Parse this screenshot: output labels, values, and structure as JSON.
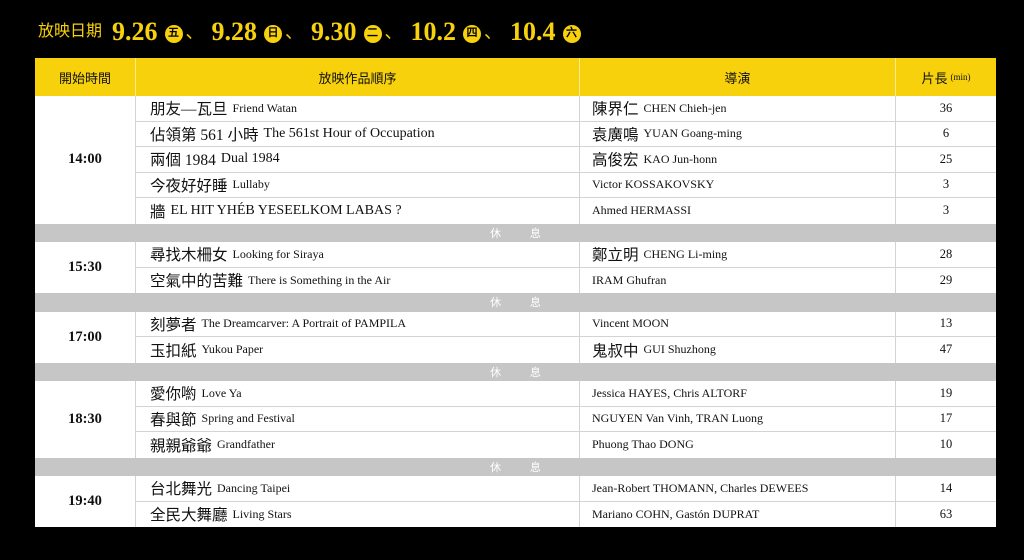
{
  "colors": {
    "page_background": "#000000",
    "accent_yellow": "#f7d10c",
    "intermission_gray": "#c6c6c6",
    "grid_line": "#d3d3d3",
    "text": "#111111"
  },
  "header": {
    "label": "放映日期",
    "separator": "、",
    "dates": [
      {
        "date": "9.26",
        "weekday": "五"
      },
      {
        "date": "9.28",
        "weekday": "日"
      },
      {
        "date": "9.30",
        "weekday": "二"
      },
      {
        "date": "10.2",
        "weekday": "四"
      },
      {
        "date": "10.4",
        "weekday": "六"
      }
    ]
  },
  "table": {
    "columns": {
      "start_time": "開始時間",
      "program": "放映作品順序",
      "director": "導演",
      "length": "片長",
      "length_unit": "(min)"
    },
    "break_label": "休 息",
    "sessions": [
      {
        "time": "14:00",
        "films": [
          {
            "title_zh": "朋友—瓦旦",
            "title_en": "Friend Watan",
            "director_zh": "陳界仁",
            "director_en": "CHEN Chieh-jen",
            "length": "36"
          },
          {
            "title_zh": "佔領第 561 小時",
            "title_en": "The 561st Hour of Occupation",
            "director_zh": "袁廣鳴",
            "director_en": "YUAN Goang-ming",
            "length": "6"
          },
          {
            "title_zh": "兩個 1984",
            "title_en": "Dual 1984",
            "director_zh": "高俊宏",
            "director_en": "KAO Jun-honn",
            "length": "25"
          },
          {
            "title_zh": "今夜好好睡",
            "title_en": "Lullaby",
            "director_en": "Victor KOSSAKOVSKY",
            "length": "3"
          },
          {
            "title_zh": "牆",
            "title_en": "EL HIT YHÉB YESEELKOM LABAS ?",
            "director_en": "Ahmed HERMASSI",
            "length": "3"
          }
        ]
      },
      {
        "time": "15:30",
        "films": [
          {
            "title_zh": "尋找木柵女",
            "title_en": "Looking for Siraya",
            "director_zh": "鄭立明",
            "director_en": "CHENG Li-ming",
            "length": "28"
          },
          {
            "title_zh": "空氣中的苦難",
            "title_en": "There is Something in the Air",
            "director_en": "IRAM Ghufran",
            "length": "29"
          }
        ]
      },
      {
        "time": "17:00",
        "films": [
          {
            "title_zh": "刻夢者",
            "title_en": "The Dreamcarver: A Portrait of PAMPILA",
            "director_en": "Vincent MOON",
            "length": "13"
          },
          {
            "title_zh": "玉扣紙",
            "title_en": "Yukou Paper",
            "director_zh": "鬼叔中",
            "director_en": "GUI Shuzhong",
            "length": "47"
          }
        ]
      },
      {
        "time": "18:30",
        "films": [
          {
            "title_zh": "愛你喲",
            "title_en": "Love Ya",
            "director_en": "Jessica HAYES, Chris ALTORF",
            "length": "19"
          },
          {
            "title_zh": "春與節",
            "title_en": "Spring and Festival",
            "director_en": "NGUYEN Van Vinh, TRAN Luong",
            "length": "17"
          },
          {
            "title_zh": "親親爺爺",
            "title_en": "Grandfather",
            "director_en": "Phuong Thao DONG",
            "length": "10"
          }
        ]
      },
      {
        "time": "19:40",
        "films": [
          {
            "title_zh": "台北舞光",
            "title_en": "Dancing Taipei",
            "director_en": "Jean-Robert THOMANN, Charles DEWEES",
            "length": "14"
          },
          {
            "title_zh": "全民大舞廳",
            "title_en": "Living Stars",
            "director_en": "Mariano COHN, Gastón DUPRAT",
            "length": "63"
          }
        ]
      }
    ]
  }
}
